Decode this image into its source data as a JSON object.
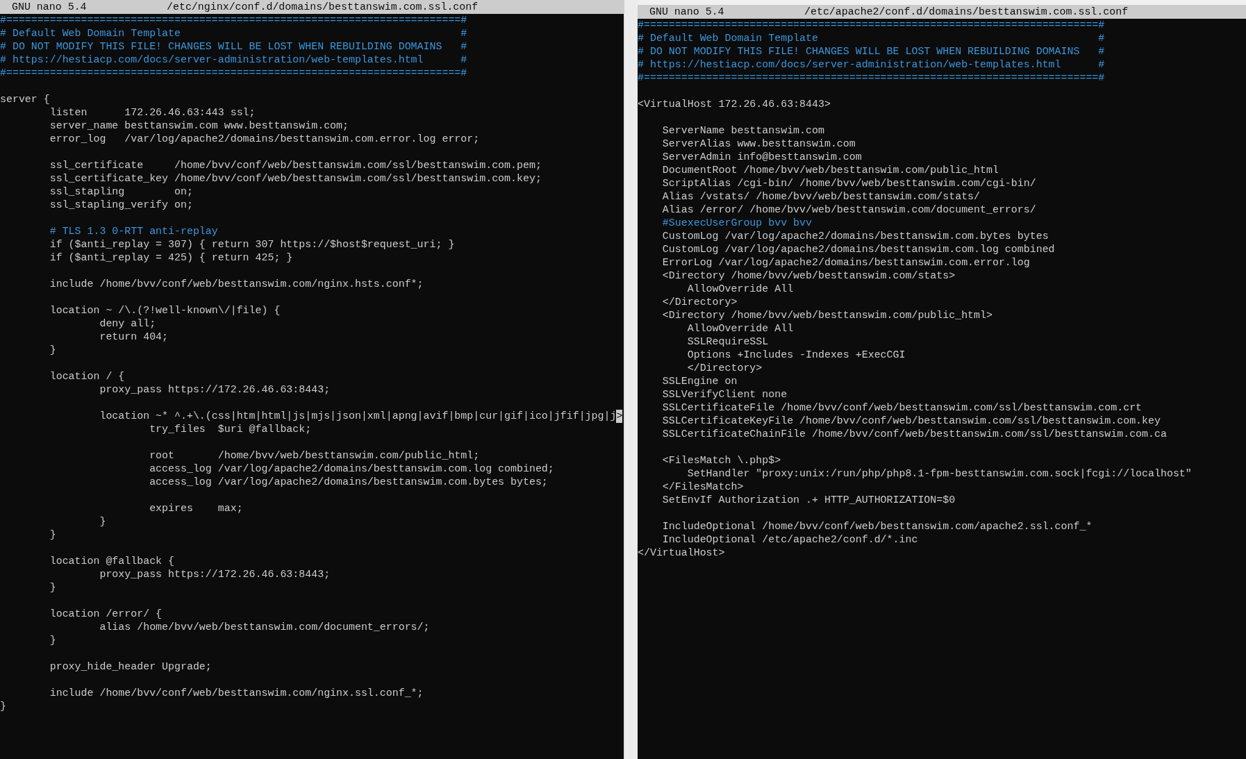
{
  "panes": [
    {
      "header": {
        "program": "GNU nano 5.4",
        "filename": "/etc/nginx/conf.d/domains/besttanswim.com.ssl.conf"
      },
      "lines": [
        {
          "kind": "comment",
          "text": "#=========================================================================#"
        },
        {
          "kind": "comment",
          "text": "# Default Web Domain Template                                             #"
        },
        {
          "kind": "comment",
          "text": "# DO NOT MODIFY THIS FILE! CHANGES WILL BE LOST WHEN REBUILDING DOMAINS   #"
        },
        {
          "kind": "comment",
          "text": "# https://hestiacp.com/docs/server-administration/web-templates.html      #"
        },
        {
          "kind": "comment",
          "text": "#=========================================================================#"
        },
        {
          "kind": "blank"
        },
        {
          "kind": "code",
          "text": "server {"
        },
        {
          "kind": "code",
          "text": "        listen      172.26.46.63:443 ssl;"
        },
        {
          "kind": "code",
          "text": "        server_name besttanswim.com www.besttanswim.com;"
        },
        {
          "kind": "code",
          "text": "        error_log   /var/log/apache2/domains/besttanswim.com.error.log error;"
        },
        {
          "kind": "blank"
        },
        {
          "kind": "code",
          "text": "        ssl_certificate     /home/bvv/conf/web/besttanswim.com/ssl/besttanswim.com.pem;"
        },
        {
          "kind": "code",
          "text": "        ssl_certificate_key /home/bvv/conf/web/besttanswim.com/ssl/besttanswim.com.key;"
        },
        {
          "kind": "code",
          "text": "        ssl_stapling        on;"
        },
        {
          "kind": "code",
          "text": "        ssl_stapling_verify on;"
        },
        {
          "kind": "blank"
        },
        {
          "kind": "comment",
          "text": "        # TLS 1.3 0-RTT anti-replay"
        },
        {
          "kind": "code",
          "text": "        if ($anti_replay = 307) { return 307 https://$host$request_uri; }"
        },
        {
          "kind": "code",
          "text": "        if ($anti_replay = 425) { return 425; }"
        },
        {
          "kind": "blank"
        },
        {
          "kind": "code",
          "text": "        include /home/bvv/conf/web/besttanswim.com/nginx.hsts.conf*;"
        },
        {
          "kind": "blank"
        },
        {
          "kind": "code",
          "text": "        location ~ /\\.(?!well-known\\/|file) {"
        },
        {
          "kind": "code",
          "text": "                deny all;"
        },
        {
          "kind": "code",
          "text": "                return 404;"
        },
        {
          "kind": "code",
          "text": "        }"
        },
        {
          "kind": "blank"
        },
        {
          "kind": "code",
          "text": "        location / {"
        },
        {
          "kind": "code",
          "text": "                proxy_pass https://172.26.46.63:8443;"
        },
        {
          "kind": "blank"
        },
        {
          "kind": "code",
          "text": "                location ~* ^.+\\.(css|htm|html|js|mjs|json|xml|apng|avif|bmp|cur|gif|ico|jfif|jpg|j",
          "more": ">"
        },
        {
          "kind": "code",
          "text": "                        try_files  $uri @fallback;"
        },
        {
          "kind": "blank"
        },
        {
          "kind": "code",
          "text": "                        root       /home/bvv/web/besttanswim.com/public_html;"
        },
        {
          "kind": "code",
          "text": "                        access_log /var/log/apache2/domains/besttanswim.com.log combined;"
        },
        {
          "kind": "code",
          "text": "                        access_log /var/log/apache2/domains/besttanswim.com.bytes bytes;"
        },
        {
          "kind": "blank"
        },
        {
          "kind": "code",
          "text": "                        expires    max;"
        },
        {
          "kind": "code",
          "text": "                }"
        },
        {
          "kind": "code",
          "text": "        }"
        },
        {
          "kind": "blank"
        },
        {
          "kind": "code",
          "text": "        location @fallback {"
        },
        {
          "kind": "code",
          "text": "                proxy_pass https://172.26.46.63:8443;"
        },
        {
          "kind": "code",
          "text": "        }"
        },
        {
          "kind": "blank"
        },
        {
          "kind": "code",
          "text": "        location /error/ {"
        },
        {
          "kind": "code",
          "text": "                alias /home/bvv/web/besttanswim.com/document_errors/;"
        },
        {
          "kind": "code",
          "text": "        }"
        },
        {
          "kind": "blank"
        },
        {
          "kind": "code",
          "text": "        proxy_hide_header Upgrade;"
        },
        {
          "kind": "blank"
        },
        {
          "kind": "code",
          "text": "        include /home/bvv/conf/web/besttanswim.com/nginx.ssl.conf_*;"
        },
        {
          "kind": "code",
          "text": "}"
        }
      ]
    },
    {
      "header": {
        "program": "GNU nano 5.4",
        "filename": "/etc/apache2/conf.d/domains/besttanswim.com.ssl.conf"
      },
      "lines": [
        {
          "kind": "comment",
          "text": "#=========================================================================#"
        },
        {
          "kind": "comment",
          "text": "# Default Web Domain Template                                             #"
        },
        {
          "kind": "comment",
          "text": "# DO NOT MODIFY THIS FILE! CHANGES WILL BE LOST WHEN REBUILDING DOMAINS   #"
        },
        {
          "kind": "comment",
          "text": "# https://hestiacp.com/docs/server-administration/web-templates.html      #"
        },
        {
          "kind": "comment",
          "text": "#=========================================================================#"
        },
        {
          "kind": "blank"
        },
        {
          "kind": "code",
          "text": "<VirtualHost 172.26.46.63:8443>"
        },
        {
          "kind": "blank"
        },
        {
          "kind": "code",
          "text": "    ServerName besttanswim.com"
        },
        {
          "kind": "code",
          "text": "    ServerAlias www.besttanswim.com"
        },
        {
          "kind": "code",
          "text": "    ServerAdmin info@besttanswim.com"
        },
        {
          "kind": "code",
          "text": "    DocumentRoot /home/bvv/web/besttanswim.com/public_html"
        },
        {
          "kind": "code",
          "text": "    ScriptAlias /cgi-bin/ /home/bvv/web/besttanswim.com/cgi-bin/"
        },
        {
          "kind": "code",
          "text": "    Alias /vstats/ /home/bvv/web/besttanswim.com/stats/"
        },
        {
          "kind": "code",
          "text": "    Alias /error/ /home/bvv/web/besttanswim.com/document_errors/"
        },
        {
          "kind": "comment",
          "text": "    #SuexecUserGroup bvv bvv"
        },
        {
          "kind": "code",
          "text": "    CustomLog /var/log/apache2/domains/besttanswim.com.bytes bytes"
        },
        {
          "kind": "code",
          "text": "    CustomLog /var/log/apache2/domains/besttanswim.com.log combined"
        },
        {
          "kind": "code",
          "text": "    ErrorLog /var/log/apache2/domains/besttanswim.com.error.log"
        },
        {
          "kind": "code",
          "text": "    <Directory /home/bvv/web/besttanswim.com/stats>"
        },
        {
          "kind": "code",
          "text": "        AllowOverride All"
        },
        {
          "kind": "code",
          "text": "    </Directory>"
        },
        {
          "kind": "code",
          "text": "    <Directory /home/bvv/web/besttanswim.com/public_html>"
        },
        {
          "kind": "code",
          "text": "        AllowOverride All"
        },
        {
          "kind": "code",
          "text": "        SSLRequireSSL"
        },
        {
          "kind": "code",
          "text": "        Options +Includes -Indexes +ExecCGI"
        },
        {
          "kind": "code",
          "text": "        </Directory>"
        },
        {
          "kind": "code",
          "text": "    SSLEngine on"
        },
        {
          "kind": "code",
          "text": "    SSLVerifyClient none"
        },
        {
          "kind": "code",
          "text": "    SSLCertificateFile /home/bvv/conf/web/besttanswim.com/ssl/besttanswim.com.crt"
        },
        {
          "kind": "code",
          "text": "    SSLCertificateKeyFile /home/bvv/conf/web/besttanswim.com/ssl/besttanswim.com.key"
        },
        {
          "kind": "code",
          "text": "    SSLCertificateChainFile /home/bvv/conf/web/besttanswim.com/ssl/besttanswim.com.ca"
        },
        {
          "kind": "blank"
        },
        {
          "kind": "code",
          "text": "    <FilesMatch \\.php$>"
        },
        {
          "kind": "code",
          "text": "        SetHandler \"proxy:unix:/run/php/php8.1-fpm-besttanswim.com.sock|fcgi://localhost\""
        },
        {
          "kind": "code",
          "text": "    </FilesMatch>"
        },
        {
          "kind": "code",
          "text": "    SetEnvIf Authorization .+ HTTP_AUTHORIZATION=$0"
        },
        {
          "kind": "blank"
        },
        {
          "kind": "code",
          "text": "    IncludeOptional /home/bvv/conf/web/besttanswim.com/apache2.ssl.conf_*"
        },
        {
          "kind": "code",
          "text": "    IncludeOptional /etc/apache2/conf.d/*.inc"
        },
        {
          "kind": "code",
          "text": "</VirtualHost>"
        }
      ]
    }
  ]
}
